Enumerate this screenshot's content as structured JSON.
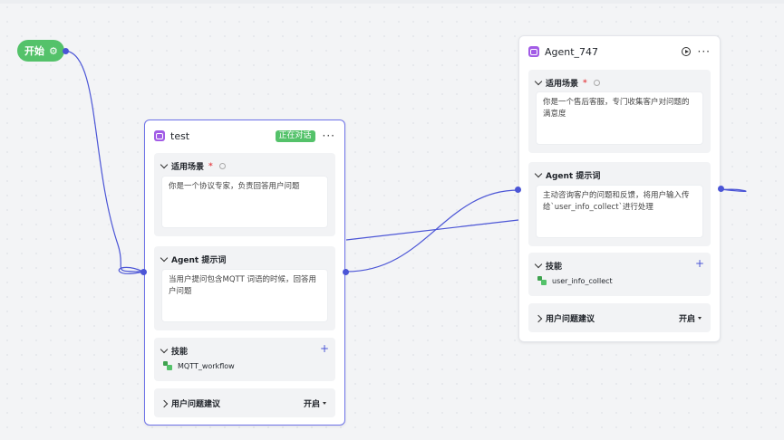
{
  "start": {
    "label": "开始",
    "icon": "gear-icon"
  },
  "nodes": {
    "test": {
      "title": "test",
      "badge": "正在对话",
      "scenario": {
        "label": "适用场景",
        "required": "*",
        "text": "你是一个协议专家，负责回答用户问题"
      },
      "prompt": {
        "label": "Agent 提示词",
        "text": "当用户提问包含MQTT 词语的时候，回答用户问题"
      },
      "skills": {
        "label": "技能",
        "items": [
          "MQTT_workflow"
        ]
      },
      "suggestion": {
        "label": "用户问题建议",
        "value": "开启"
      }
    },
    "agent747": {
      "title": "Agent_747",
      "scenario": {
        "label": "适用场景",
        "required": "*",
        "text": "你是一个售后客服，专门收集客户对问题的满意度"
      },
      "prompt": {
        "label": "Agent 提示词",
        "text": "主动咨询客户的问题和反馈，将用户输入传给`user_info_collect`进行处理"
      },
      "skills": {
        "label": "技能",
        "items": [
          "user_info_collect"
        ]
      },
      "suggestion": {
        "label": "用户问题建议",
        "value": "开启"
      }
    }
  },
  "colors": {
    "accent": "#4b55d6",
    "start": "#54c26a",
    "badge": "#54c26a",
    "agent_icon": "#a25ce6",
    "selected_border": "#6d72e8"
  }
}
